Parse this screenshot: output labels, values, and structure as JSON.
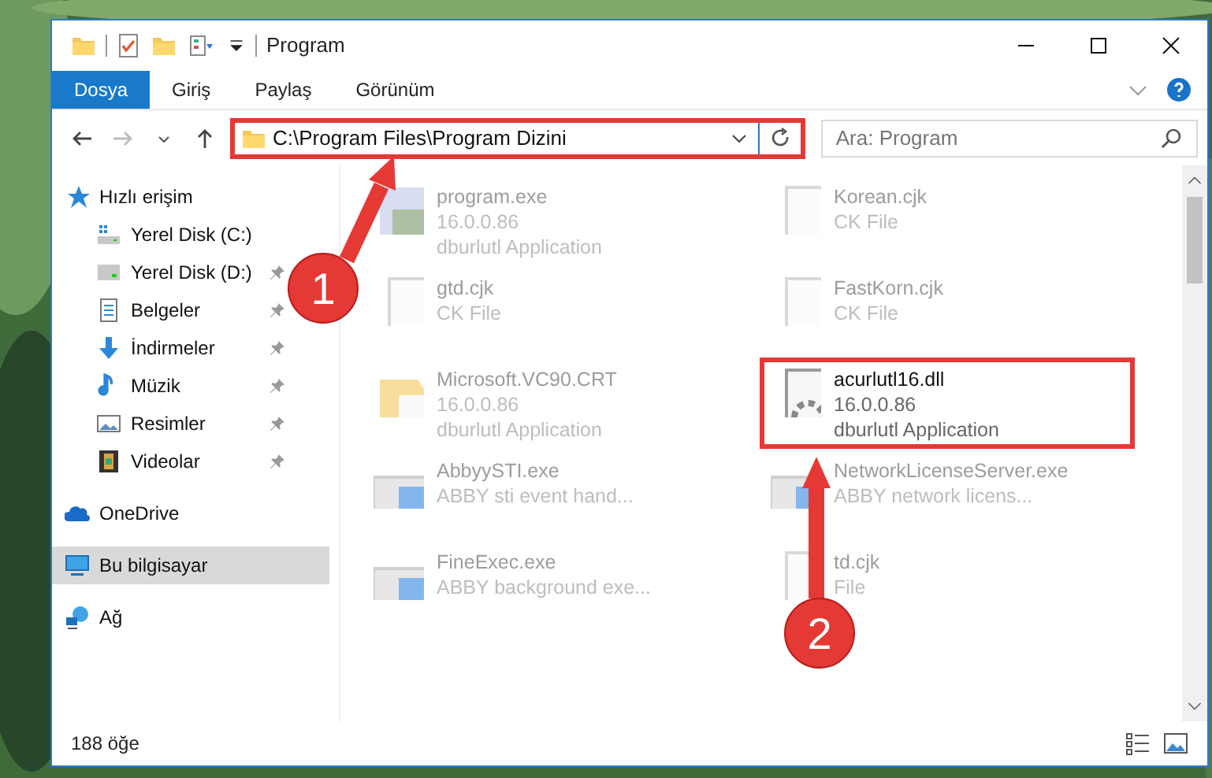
{
  "window": {
    "title": "Program"
  },
  "ribbon_tabs": [
    {
      "label": "Dosya",
      "selected": true
    },
    {
      "label": "Giriş",
      "selected": false
    },
    {
      "label": "Paylaş",
      "selected": false
    },
    {
      "label": "Görünüm",
      "selected": false
    }
  ],
  "address": {
    "value": "C:\\Program Files\\Program Dizini",
    "highlighted": true
  },
  "search": {
    "placeholder": "Ara: Program"
  },
  "nav": [
    {
      "label": "Hızlı erişim",
      "kind": "quick",
      "selected": false,
      "children": [
        {
          "label": "Yerel Disk (C:)",
          "kind": "drive-c",
          "pinned": false,
          "selected": false
        },
        {
          "label": "Yerel Disk (D:)",
          "kind": "drive",
          "pinned": true,
          "selected": false
        },
        {
          "label": "Belgeler",
          "kind": "docs",
          "pinned": true,
          "selected": false
        },
        {
          "label": "İndirmeler",
          "kind": "download",
          "pinned": true,
          "selected": false
        },
        {
          "label": "Müzik",
          "kind": "music",
          "pinned": true,
          "selected": false
        },
        {
          "label": "Resimler",
          "kind": "pictures",
          "pinned": true,
          "selected": false
        },
        {
          "label": "Videolar",
          "kind": "video",
          "pinned": true,
          "selected": false
        }
      ]
    },
    {
      "label": "OneDrive",
      "kind": "cloud",
      "selected": false
    },
    {
      "label": "Bu bilgisayar",
      "kind": "pc",
      "selected": true
    },
    {
      "label": "Ağ",
      "kind": "network",
      "selected": false
    }
  ],
  "files": [
    {
      "name": "program.exe",
      "lines": [
        "16.0.0.86",
        "dburlutl Application"
      ],
      "kind": "app",
      "blurred": true,
      "highlighted": false
    },
    {
      "name": "Korean.cjk",
      "lines": [
        "CK File"
      ],
      "kind": "doc",
      "blurred": true,
      "highlighted": false
    },
    {
      "name": "gtd.cjk",
      "lines": [
        "CK File"
      ],
      "kind": "doc",
      "blurred": true,
      "highlighted": false
    },
    {
      "name": "FastKorn.cjk",
      "lines": [
        "CK File"
      ],
      "kind": "doc",
      "blurred": true,
      "highlighted": false
    },
    {
      "name": "Microsoft.VC90.CRT",
      "lines": [
        "16.0.0.86",
        "dburlutl Application"
      ],
      "kind": "folder",
      "blurred": true,
      "highlighted": false
    },
    {
      "name": "acurlutl16.dll",
      "lines": [
        "16.0.0.86",
        "dburlutl Application"
      ],
      "kind": "gear",
      "blurred": false,
      "highlighted": true
    },
    {
      "name": "AbbyySTI.exe",
      "lines": [
        "ABBY sti event hand..."
      ],
      "kind": "window",
      "blurred": true,
      "highlighted": false
    },
    {
      "name": "NetworkLicenseServer.exe",
      "lines": [
        "ABBY network licens..."
      ],
      "kind": "window",
      "blurred": true,
      "highlighted": false
    },
    {
      "name": "FineExec.exe",
      "lines": [
        "ABBY background exe..."
      ],
      "kind": "window",
      "blurred": true,
      "highlighted": false
    },
    {
      "name": "td.cjk",
      "lines": [
        "File"
      ],
      "kind": "doc",
      "blurred": true,
      "highlighted": false
    }
  ],
  "annotations": [
    {
      "label": "1"
    },
    {
      "label": "2"
    }
  ],
  "status_bar": {
    "count": "188 öğe"
  }
}
